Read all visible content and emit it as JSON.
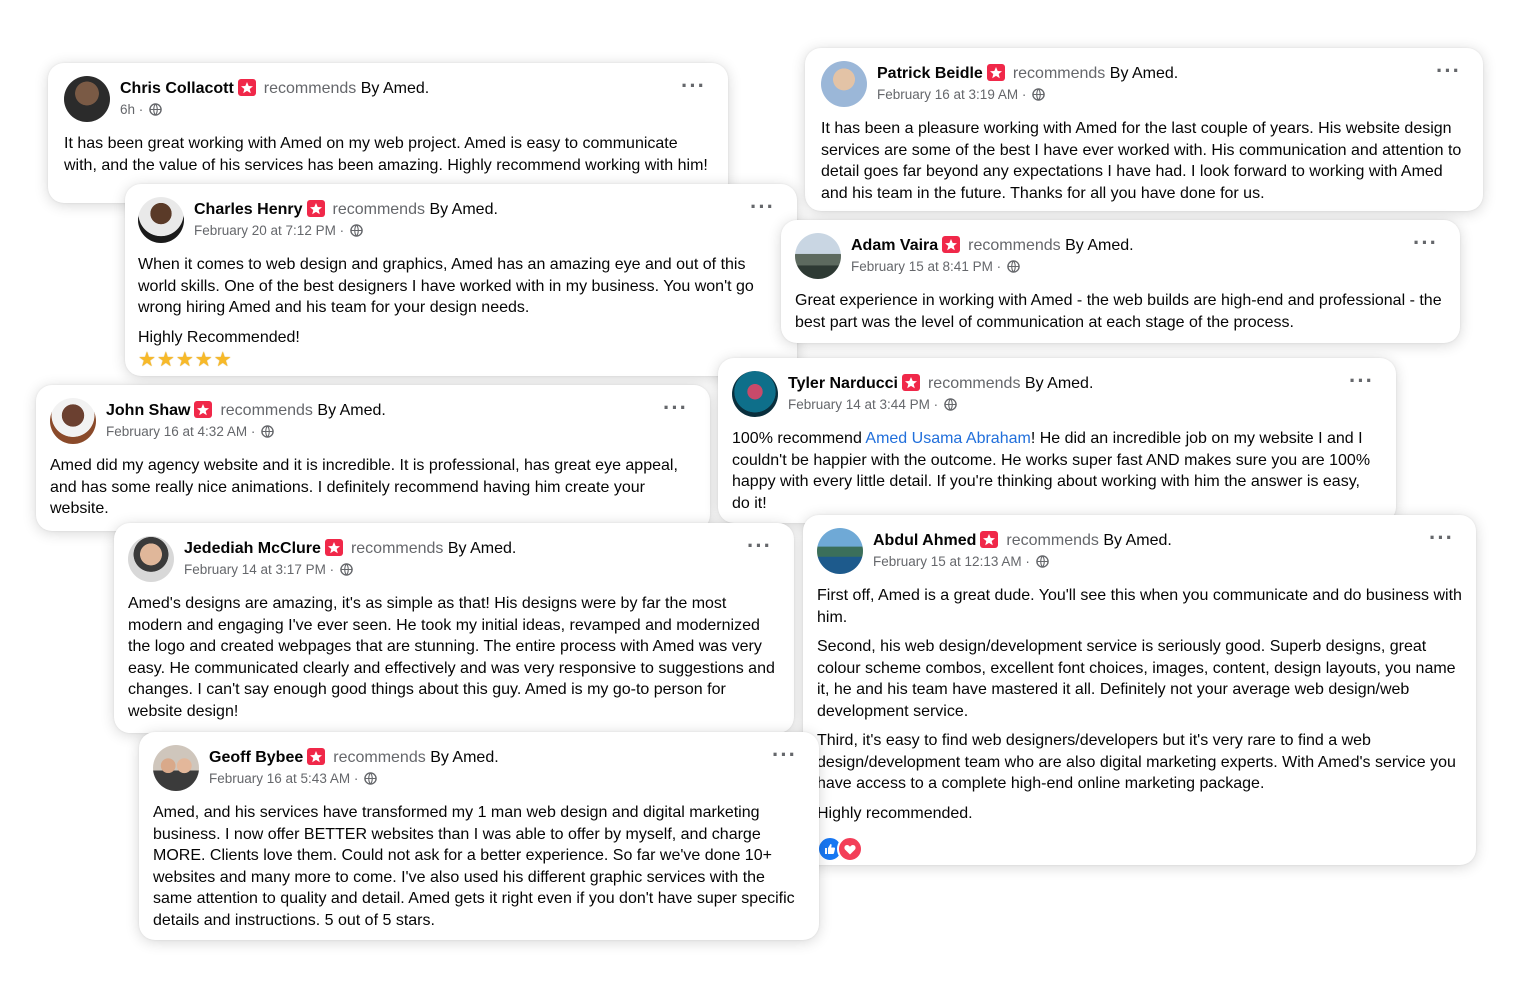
{
  "common": {
    "recommends": "recommends",
    "by": "By Amed.",
    "separator": "·"
  },
  "reviews": [
    {
      "name": "Chris Collacott",
      "time": "6h",
      "paragraphs": [
        "It has been great working with Amed on my web project.  Amed is easy to communicate with, and the value of his services has been amazing.  Highly recommend working with him!"
      ]
    },
    {
      "name": "Patrick Beidle",
      "time": "February 16 at 3:19 AM",
      "paragraphs": [
        "It has been a pleasure working with Amed for the last couple of years.  His website design services are some of the best I have ever worked with.  His communication and attention to detail goes far beyond any expectations I have had.  I look forward to working with Amed and his team in the future.  Thanks for all you have done for us."
      ]
    },
    {
      "name": "Charles Henry",
      "time": "February 20 at 7:12 PM",
      "paragraphs": [
        "When it comes to web design and graphics, Amed has an amazing eye and out of this world skills. One of the best designers I have worked with in my business. You won't go wrong hiring Amed and his team for your design needs.",
        "Highly Recommended!"
      ],
      "stars": "★★★★★"
    },
    {
      "name": "Adam Vaira",
      "time": "February 15 at 8:41 PM",
      "paragraphs": [
        "Great experience in working with Amed - the web builds are high-end and professional - the best part was the  level of communication at each stage of the process."
      ]
    },
    {
      "name": "John Shaw",
      "time": "February 16 at 4:32 AM",
      "paragraphs": [
        "Amed did my agency website and it is incredible. It is professional, has great eye appeal, and has some really nice animations. I definitely recommend having him create your website."
      ]
    },
    {
      "name": "Tyler Narducci",
      "time": "February 14 at 3:44 PM",
      "lead": "100% recommend ",
      "mention": "Amed Usama Abraham",
      "rest": "! He did an incredible job on my website I and I couldn't be happier with the outcome. He works super fast AND makes sure you are 100% happy with every little detail. If you're thinking about working with him the answer is easy, do it!"
    },
    {
      "name": "Jedediah McClure",
      "time": "February 14 at 3:17 PM",
      "paragraphs": [
        "Amed's designs are amazing, it's as simple as that! His designs were by far the most modern and engaging I've ever seen. He took my initial ideas, revamped and modernized the logo and created webpages that are stunning. The entire process with Amed was very easy. He communicated clearly and effectively and was very responsive to suggestions and changes. I can't say enough good things about this guy. Amed is my go-to person for website design!"
      ]
    },
    {
      "name": "Abdul Ahmed",
      "time": "February 15 at 12:13 AM",
      "paragraphs": [
        "First off, Amed is a great dude. You'll see this when you communicate and do business with him.",
        "Second, his web design/development service is seriously good. Superb designs, great colour scheme combos, excellent font choices, images, content, design layouts, you name it, he and his team have mastered it all. Definitely not your average web design/web development service.",
        "Third, it's easy to find web designers/developers but it's very rare to find a web design/development team who are also digital marketing experts. With Amed's service you have access to a complete high-end online marketing package.",
        "Highly recommended."
      ]
    },
    {
      "name": "Geoff Bybee",
      "time": "February 16 at 5:43 AM",
      "paragraphs": [
        "Amed, and his services have transformed my 1 man web design and digital marketing business. I now offer BETTER websites than I was able to offer by myself, and charge MORE. Clients love them. Could not ask for a better experience. So far we've done 10+ websites and many more to come. I've also used his different graphic services with the same attention to quality and detail. Amed gets it right even if you don't have super specific details and instructions. 5 out of 5 stars."
      ]
    }
  ]
}
